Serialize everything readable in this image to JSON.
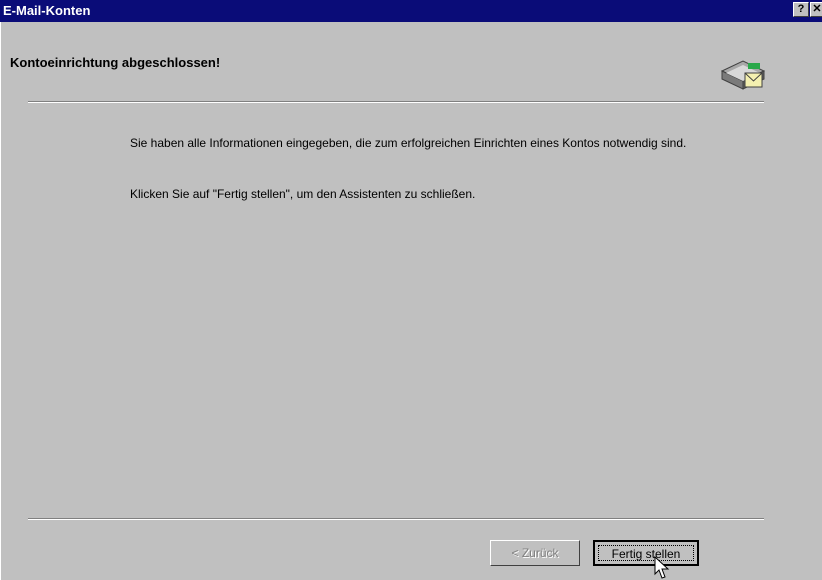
{
  "window": {
    "title": "E-Mail-Konten",
    "help_label": "?",
    "close_label": "✕"
  },
  "page": {
    "heading": "Kontoeinrichtung abgeschlossen!",
    "paragraph1": "Sie haben alle Informationen eingegeben, die zum erfolgreichen Einrichten eines Kontos notwendig sind.",
    "paragraph2": "Klicken Sie auf \"Fertig stellen\", um den Assistenten zu schließen.",
    "icon": "mail-envelope-icon"
  },
  "buttons": {
    "back_label": "< Zurück",
    "finish_label": "Fertig stellen"
  }
}
